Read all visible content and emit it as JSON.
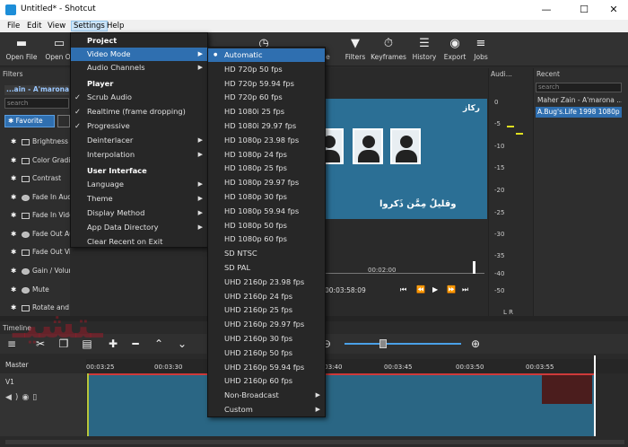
{
  "window": {
    "title": "Untitled* - Shotcut",
    "controls": [
      "—",
      "☐",
      "✕"
    ]
  },
  "menubar": [
    "File",
    "Edit",
    "View",
    "Settings",
    "Help"
  ],
  "toolbar": {
    "left": [
      {
        "label": "Open File",
        "icon": "folder-icon"
      },
      {
        "label": "Open Ot",
        "icon": "folder-open-icon"
      }
    ],
    "right": [
      {
        "label": "",
        "icon": "clock-icon"
      },
      {
        "label": "line",
        "icon": "timeline-icon"
      },
      {
        "label": "Filters",
        "icon": "filter-icon"
      },
      {
        "label": "Keyframes",
        "icon": "stopwatch-icon"
      },
      {
        "label": "History",
        "icon": "history-icon"
      },
      {
        "label": "Export",
        "icon": "disc-icon"
      },
      {
        "label": "Jobs",
        "icon": "database-icon"
      }
    ]
  },
  "filters_panel": {
    "title": "Filters",
    "current_clip": "...ain - A'marona ...",
    "search_placeholder": "search",
    "favorite_button": "Favorite",
    "items": [
      "Brightness",
      "Color Grading",
      "Contrast",
      "Fade In Audio",
      "Fade In Video",
      "Fade Out Audio",
      "Fade Out Video",
      "Gain / Volume",
      "Mute",
      "Rotate and Scale"
    ]
  },
  "preview": {
    "logo": "ركاز",
    "caption": "وقليلٌ مِمَّن ذَكروا",
    "ruler_time": "00:02:00",
    "current_time": "00:03:58:09",
    "transport": [
      "⏮",
      "⏪",
      "▶",
      "⏩",
      "⏭"
    ]
  },
  "audio_panel": {
    "title": "Audi...",
    "levels": [
      "0",
      "-5",
      "-10",
      "-15",
      "-20",
      "-25",
      "-30",
      "-35",
      "-40",
      "-50"
    ],
    "channels": "L  R"
  },
  "recent_panel": {
    "title": "Recent",
    "search_placeholder": "search",
    "items": [
      "Maher Zain - A'marona ...",
      "A.Bug's.Life 1998 1080p ..."
    ]
  },
  "timeline": {
    "title": "Timeline",
    "master_label": "Master",
    "track": "V1",
    "ticks": [
      "00:03:25",
      "00:03:30",
      "00:03:40",
      "00:03:45",
      "00:03:50",
      "00:03:55"
    ]
  },
  "settings_menu": {
    "items": [
      {
        "label": "Project",
        "section": true
      },
      {
        "label": "Video Mode",
        "submenu": true,
        "highlighted": true
      },
      {
        "label": "Audio Channels",
        "submenu": true
      },
      {
        "label": "Player",
        "section": true
      },
      {
        "label": "Scrub Audio",
        "checked": true
      },
      {
        "label": "Realtime (frame dropping)",
        "checked": true
      },
      {
        "label": "Progressive",
        "checked": true
      },
      {
        "label": "Deinterlacer",
        "submenu": true
      },
      {
        "label": "Interpolation",
        "submenu": true
      },
      {
        "label": "User Interface",
        "section": true
      },
      {
        "label": "Language",
        "submenu": true
      },
      {
        "label": "Theme",
        "submenu": true
      },
      {
        "label": "Display Method",
        "submenu": true
      },
      {
        "label": "App Data Directory",
        "submenu": true
      },
      {
        "label": "Clear Recent on Exit"
      }
    ]
  },
  "video_mode_menu": {
    "items": [
      "Automatic",
      "HD 720p 50 fps",
      "HD 720p 59.94 fps",
      "HD 720p 60 fps",
      "HD 1080i 25 fps",
      "HD 1080i 29.97 fps",
      "HD 1080p 23.98 fps",
      "HD 1080p 24 fps",
      "HD 1080p 25 fps",
      "HD 1080p 29.97 fps",
      "HD 1080p 30 fps",
      "HD 1080p 59.94 fps",
      "HD 1080p 50 fps",
      "HD 1080p 60 fps",
      "SD NTSC",
      "SD PAL",
      "UHD 2160p 23.98 fps",
      "UHD 2160p 24 fps",
      "UHD 2160p 25 fps",
      "UHD 2160p 29.97 fps",
      "UHD 2160p 30 fps",
      "UHD 2160p 50 fps",
      "UHD 2160p 59.94 fps",
      "UHD 2160p 60 fps",
      "Non-Broadcast",
      "Custom"
    ],
    "selected": "Automatic",
    "submenu_items": [
      "Non-Broadcast",
      "Custom"
    ]
  },
  "watermark": "ـتشيـ",
  "colors": {
    "accent": "#2f6fb0",
    "clip": "#2a6684",
    "meter": "#e0e020"
  }
}
